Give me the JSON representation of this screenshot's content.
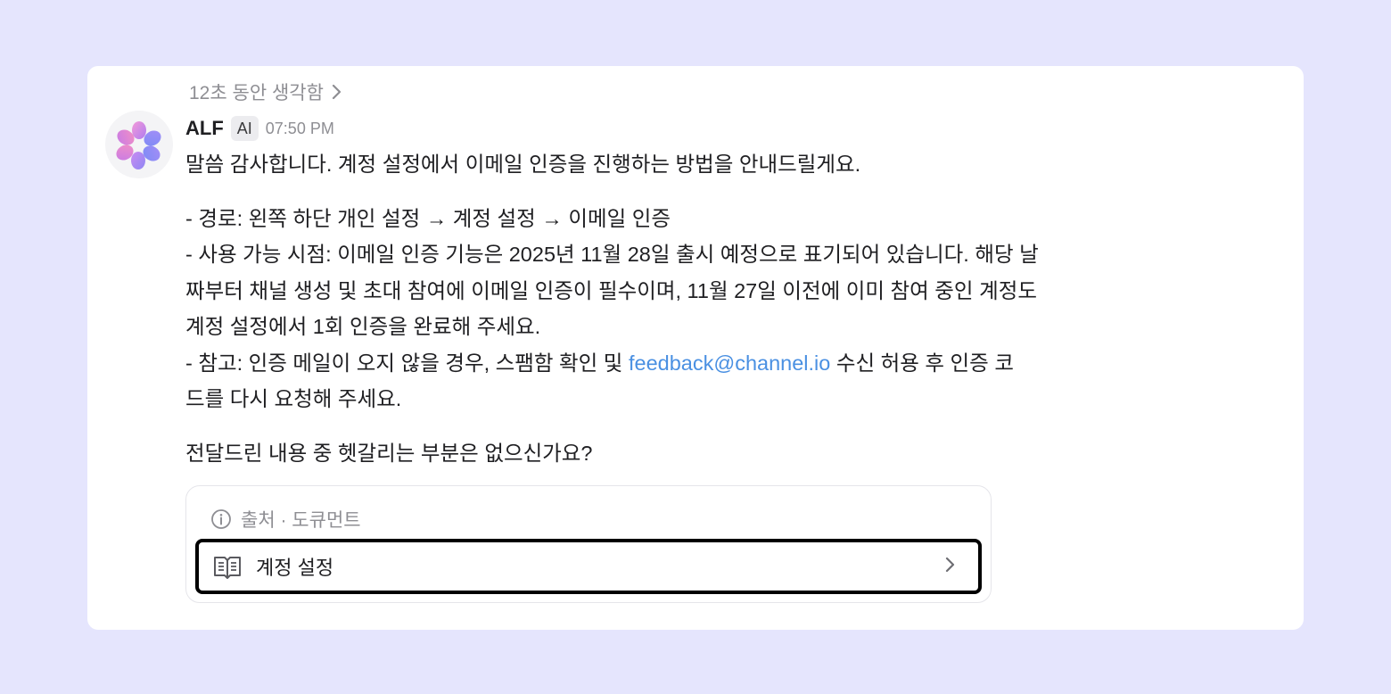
{
  "thought": {
    "label": "12초 동안 생각함"
  },
  "message": {
    "sender": "ALF",
    "badge": "AI",
    "time": "07:50 PM",
    "greeting": "말씀 감사합니다. 계정 설정에서 이메일 인증을 진행하는 방법을 안내드릴게요.",
    "route": "- 경로: 왼쪽 하단 개인 설정 → 계정 설정 → 이메일 인증",
    "availability_l1": "- 사용 가능 시점: 이메일 인증 기능은 2025년 11월 28일 출시 예정으로 표기되어 있습니다. 해당 날",
    "availability_l2": "짜부터 채널 생성 및 초대 참여에 이메일 인증이 필수이며, 11월 27일 이전에 이미 참여 중인 계정도",
    "availability_l3": "계정 설정에서 1회 인증을 완료해 주세요.",
    "note_prefix": "- 참고: 인증 메일이 오지 않을 경우, 스팸함 확인 및 ",
    "note_email": "feedback@channel.io",
    "note_suffix": " 수신 허용 후 인증 코",
    "note_l2": "드를 다시 요청해 주세요.",
    "closing": "전달드린 내용 중 헷갈리는 부분은 없으신가요?"
  },
  "source": {
    "header": "출처 · 도큐먼트",
    "doc_title": "계정 설정"
  },
  "colors": {
    "background": "#e5e5fd",
    "link": "#4a90e2",
    "highlight_border": "#000000"
  },
  "icons": {
    "thought_chevron": "chevron-right-icon",
    "avatar": "flower-logo-icon",
    "source_info": "info-icon",
    "doc": "book-icon",
    "doc_chevron": "chevron-right-icon"
  }
}
